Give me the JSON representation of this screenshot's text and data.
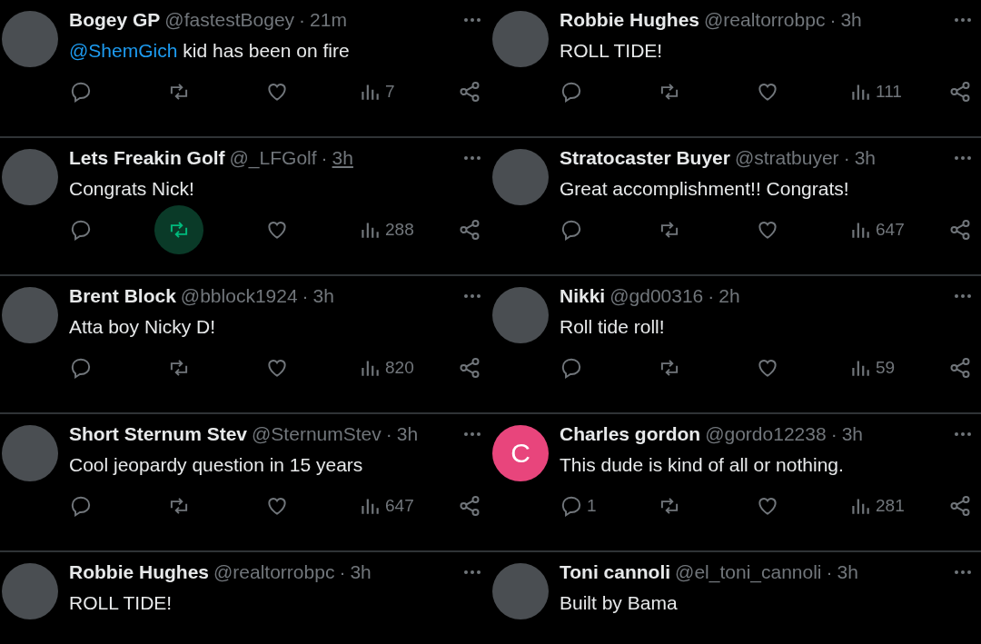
{
  "columns": [
    {
      "tweets": [
        {
          "name": "Bogey GP",
          "handle": "@fastestBogey",
          "separator": "·",
          "time": "21m",
          "time_underlined": false,
          "mention": "@ShemGich",
          "text": "kid has been on fire",
          "avatar": {
            "kind": "photo"
          },
          "reposted": false,
          "views": "7"
        },
        {
          "name": "Lets Freakin Golf",
          "handle": "@_LFGolf",
          "separator": "·",
          "time": "3h",
          "time_underlined": true,
          "text": "Congrats Nick!",
          "avatar": {
            "kind": "photo"
          },
          "reposted": true,
          "views": "288"
        },
        {
          "name": "Brent Block",
          "handle": "@bblock1924",
          "separator": "·",
          "time": "3h",
          "time_underlined": false,
          "text": "Atta boy Nicky D!",
          "avatar": {
            "kind": "photo"
          },
          "reposted": false,
          "views": "820"
        },
        {
          "name": "Short Sternum Stev",
          "handle": "@SternumStev",
          "separator": "·",
          "time": "3h",
          "time_underlined": false,
          "text": "Cool jeopardy question in 15 years",
          "avatar": {
            "kind": "photo"
          },
          "reposted": false,
          "views": "647"
        },
        {
          "name": "Robbie Hughes",
          "handle": "@realtorrobpc",
          "separator": "·",
          "time": "3h",
          "time_underlined": false,
          "text": "ROLL TIDE!",
          "avatar": {
            "kind": "photo"
          }
        }
      ]
    },
    {
      "tweets": [
        {
          "name": "Robbie Hughes",
          "handle": "@realtorrobpc",
          "separator": "·",
          "time": "3h",
          "time_underlined": false,
          "text": "ROLL TIDE!",
          "avatar": {
            "kind": "photo"
          },
          "reposted": false,
          "views": "111"
        },
        {
          "name": "Stratocaster Buyer",
          "handle": "@stratbuyer",
          "separator": "·",
          "time": "3h",
          "time_underlined": false,
          "text": "Great accomplishment!! Congrats!",
          "avatar": {
            "kind": "photo"
          },
          "reposted": false,
          "views": "647"
        },
        {
          "name": "Nikki",
          "handle": "@gd00316",
          "separator": "·",
          "time": "2h",
          "time_underlined": false,
          "text": "Roll tide roll!",
          "avatar": {
            "kind": "photo"
          },
          "reposted": false,
          "views": "59"
        },
        {
          "name": "Charles gordon",
          "handle": "@gordo12238",
          "separator": "·",
          "time": "3h",
          "time_underlined": false,
          "text": "This dude is kind of all or nothing.",
          "avatar": {
            "kind": "letter",
            "letter": "C",
            "color": "#e8457c"
          },
          "reply_count": "1",
          "reposted": false,
          "views": "281"
        },
        {
          "name": "Toni cannoli",
          "handle": "@el_toni_cannoli",
          "separator": "·",
          "time": "3h",
          "time_underlined": false,
          "text": "Built by Bama",
          "avatar": {
            "kind": "photo"
          }
        }
      ]
    }
  ]
}
